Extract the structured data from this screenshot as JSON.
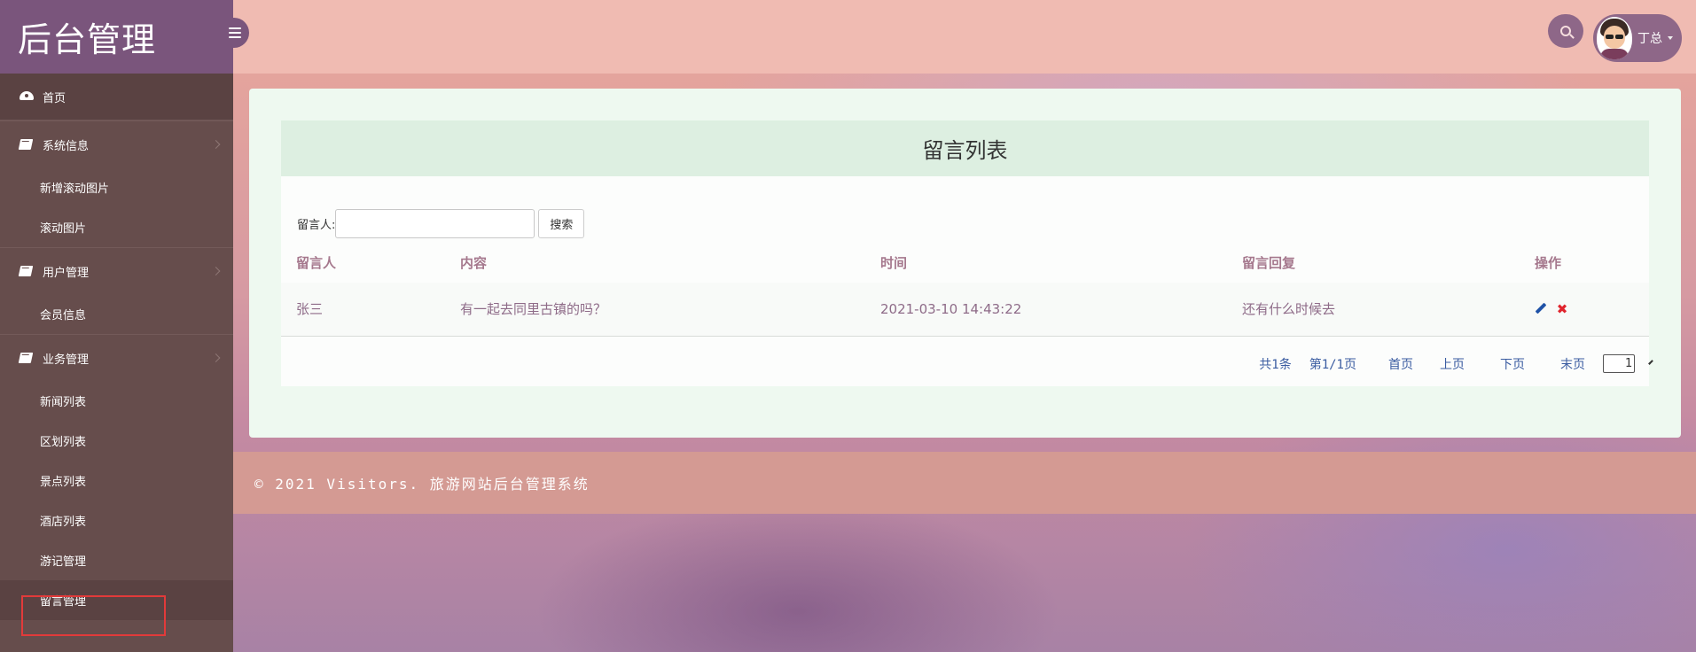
{
  "brand": {
    "title": "后台管理"
  },
  "sidebar": {
    "home": "首页",
    "groups": [
      {
        "label": "系统信息",
        "items": [
          "新增滚动图片",
          "滚动图片"
        ]
      },
      {
        "label": "用户管理",
        "items": [
          "会员信息"
        ]
      },
      {
        "label": "业务管理",
        "items": [
          "新闻列表",
          "区划列表",
          "景点列表",
          "酒店列表",
          "游记管理",
          "留言管理"
        ]
      }
    ],
    "active": "留言管理"
  },
  "header": {
    "user_name": "丁总"
  },
  "panel": {
    "title": "留言列表",
    "filter_label": "留言人:",
    "filter_value": "",
    "search_button": "搜索"
  },
  "table": {
    "headers": [
      "留言人",
      "内容",
      "时间",
      "留言回复",
      "操作"
    ],
    "rows": [
      {
        "author": "张三",
        "content": "有一起去同里古镇的吗？",
        "time": "2021-03-10 14:43:22",
        "reply": "还有什么时候去"
      }
    ]
  },
  "pager": {
    "total": "共1条",
    "page_info": "第1/1页",
    "first": "首页",
    "prev": "上页",
    "next": "下页",
    "last": "末页",
    "selected": "1"
  },
  "footer": {
    "text": "© 2021 Visitors. 旅游网站后台管理系统"
  },
  "colors": {
    "sidebar": "#664d4c",
    "brand": "#7a557c",
    "accent": "#8e6788",
    "active_outline": "#e23a3a"
  }
}
